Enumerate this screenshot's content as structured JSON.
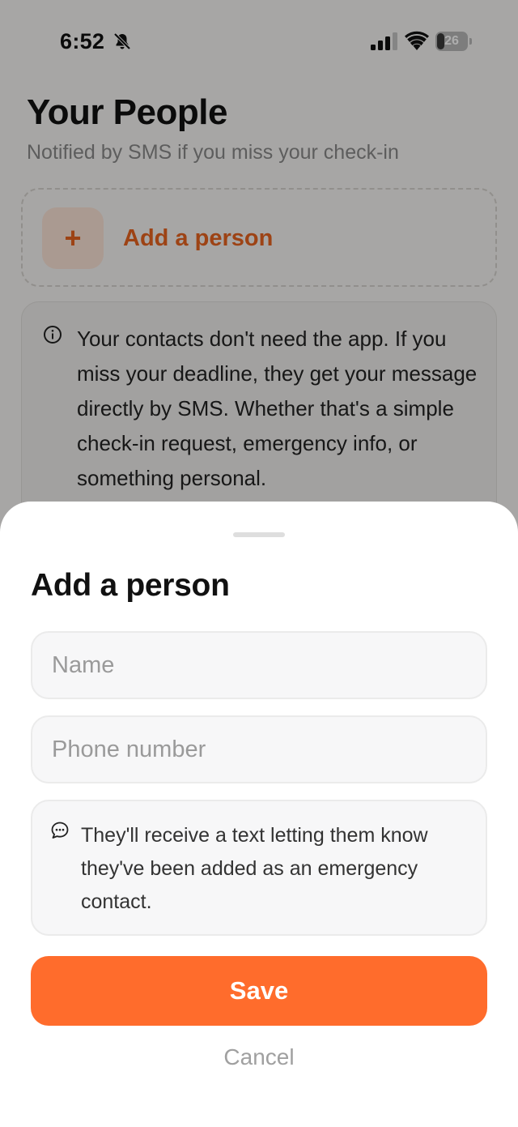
{
  "status_bar": {
    "time": "6:52",
    "battery": "26",
    "battery_level": 0.26,
    "icons": [
      "bell-slash-icon",
      "cellular-signal-icon",
      "wifi-icon",
      "battery-icon"
    ]
  },
  "page": {
    "title": "Your People",
    "subtitle": "Notified by SMS if you miss your check-in",
    "add_person": {
      "icon": "plus",
      "label": "Add a person"
    },
    "info": {
      "icon": "info-icon",
      "text": "Your contacts don't need the app. If you miss your deadline, they get your message directly by SMS. Whether that's a simple check-in request, emergency info, or something personal."
    }
  },
  "sheet": {
    "title": "Add a person",
    "name_field": {
      "placeholder": "Name",
      "value": ""
    },
    "phone_field": {
      "placeholder": "Phone number",
      "value": ""
    },
    "note": {
      "icon": "chat-bubble-icon",
      "text": "They'll receive a text letting them know they've been added as an emergency contact."
    },
    "save_label": "Save",
    "cancel_label": "Cancel"
  },
  "colors": {
    "accent": "#ff6c2c",
    "accent_text": "#e8631f",
    "accent_soft": "#fbe3d6",
    "scrim": "rgba(0,0,0,0.32)"
  }
}
